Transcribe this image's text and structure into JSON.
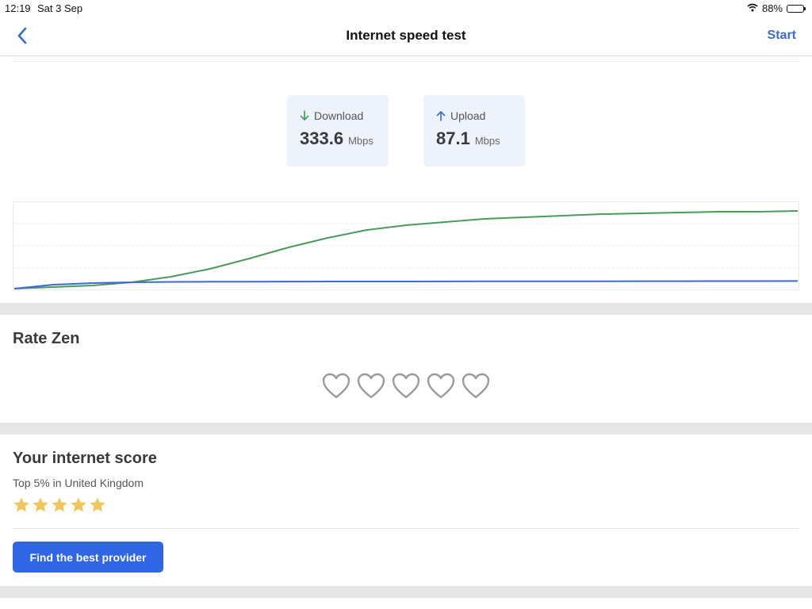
{
  "status_bar": {
    "time": "12:19",
    "date": "Sat 3 Sep",
    "battery_text": "88%",
    "battery_level": 0.88,
    "wifi_icon": "wifi-icon"
  },
  "nav": {
    "title": "Internet speed test",
    "back_icon": "chevron-left-icon",
    "start_label": "Start"
  },
  "speed": {
    "download": {
      "label": "Download",
      "value": "333.6",
      "unit": "Mbps",
      "icon": "arrow-down-icon",
      "color": "#3d9a55"
    },
    "upload": {
      "label": "Upload",
      "value": "87.1",
      "unit": "Mbps",
      "icon": "arrow-up-icon",
      "color": "#3b6ad6"
    }
  },
  "chart_data": {
    "type": "line",
    "grid": true,
    "series": [
      {
        "color": "#4a9a5a",
        "values": [
          0,
          2,
          4,
          8,
          15,
          25,
          38,
          52,
          64,
          74,
          80,
          84,
          88,
          90,
          92,
          94,
          95,
          96,
          97,
          97,
          98
        ]
      },
      {
        "color": "#3b6ad6",
        "values": [
          0,
          5,
          7,
          8,
          8.5,
          8.7,
          8.8,
          8.9,
          9,
          9,
          9,
          9.1,
          9.2,
          9.2,
          9.3,
          9.3,
          9.4,
          9.4,
          9.5,
          9.5,
          9.6
        ]
      }
    ],
    "ylim": [
      0,
      110
    ]
  },
  "rate": {
    "title": "Rate Zen",
    "hearts": 5,
    "heart_icon": "heart-outline-icon"
  },
  "score": {
    "title": "Your internet score",
    "subtitle": "Top 5% in United Kingdom",
    "stars": 5,
    "star_color": "#f2c55c",
    "button_label": "Find the best provider",
    "button_color": "#2f66e6"
  }
}
